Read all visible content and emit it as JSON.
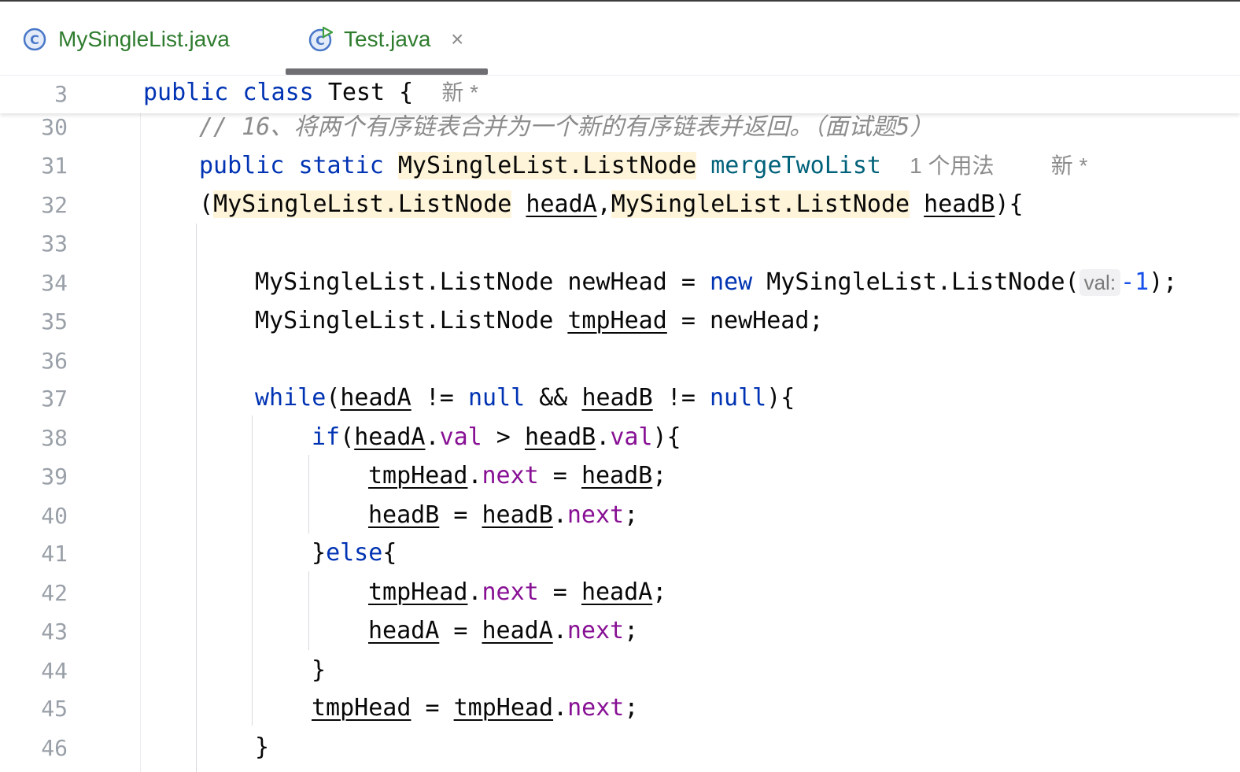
{
  "tabs": [
    {
      "label": "MySingleList.java",
      "icon": "class-icon"
    },
    {
      "label": "Test.java",
      "icon": "class-run-icon",
      "close": "×"
    }
  ],
  "sticky": {
    "line": "3",
    "kw1": "public",
    "kw2": "class",
    "name": "Test {",
    "badge": "新 *"
  },
  "lines": {
    "l30": "30",
    "l31": "31",
    "l32": "32",
    "l33": "33",
    "l34": "34",
    "l35": "35",
    "l36": "36",
    "l37": "37",
    "l38": "38",
    "l39": "39",
    "l40": "40",
    "l41": "41",
    "l42": "42",
    "l43": "43",
    "l44": "44",
    "l45": "45",
    "l46": "46"
  },
  "code": {
    "comment": "// 16、将两个有序链表合并为一个新的有序链表并返回。（面试题5）",
    "kw_public": "public",
    "kw_static": "static",
    "ret_type": "MySingleList.ListNode",
    "method": "mergeTwoList",
    "usage": "1 个用法",
    "badge": "新 *",
    "paren_open": "(",
    "param_type": "MySingleList.ListNode",
    "param_a": "headA",
    "comma": ",",
    "param_b": "headB",
    "brace_open": "){",
    "type": "MySingleList.ListNode",
    "new_head": "newHead",
    "assign": " = ",
    "kw_new": "new",
    "ctor": "MySingleList.ListNode(",
    "hint_val": "val:",
    "num": "-1",
    "end_call": ");",
    "tmp_head": "tmpHead",
    "semicolon": ";",
    "kw_while": "while",
    "open_paren": "(",
    "head_a": "headA",
    "neq": " != ",
    "kw_null": "null",
    "and": " && ",
    "head_b": "headB",
    "close_brace": "){",
    "kw_if": "if",
    "dot": ".",
    "val": "val",
    "gt": " > ",
    "next": "next",
    "else_close": "}",
    "kw_else": "else",
    "brace": "{",
    "close": "}"
  }
}
